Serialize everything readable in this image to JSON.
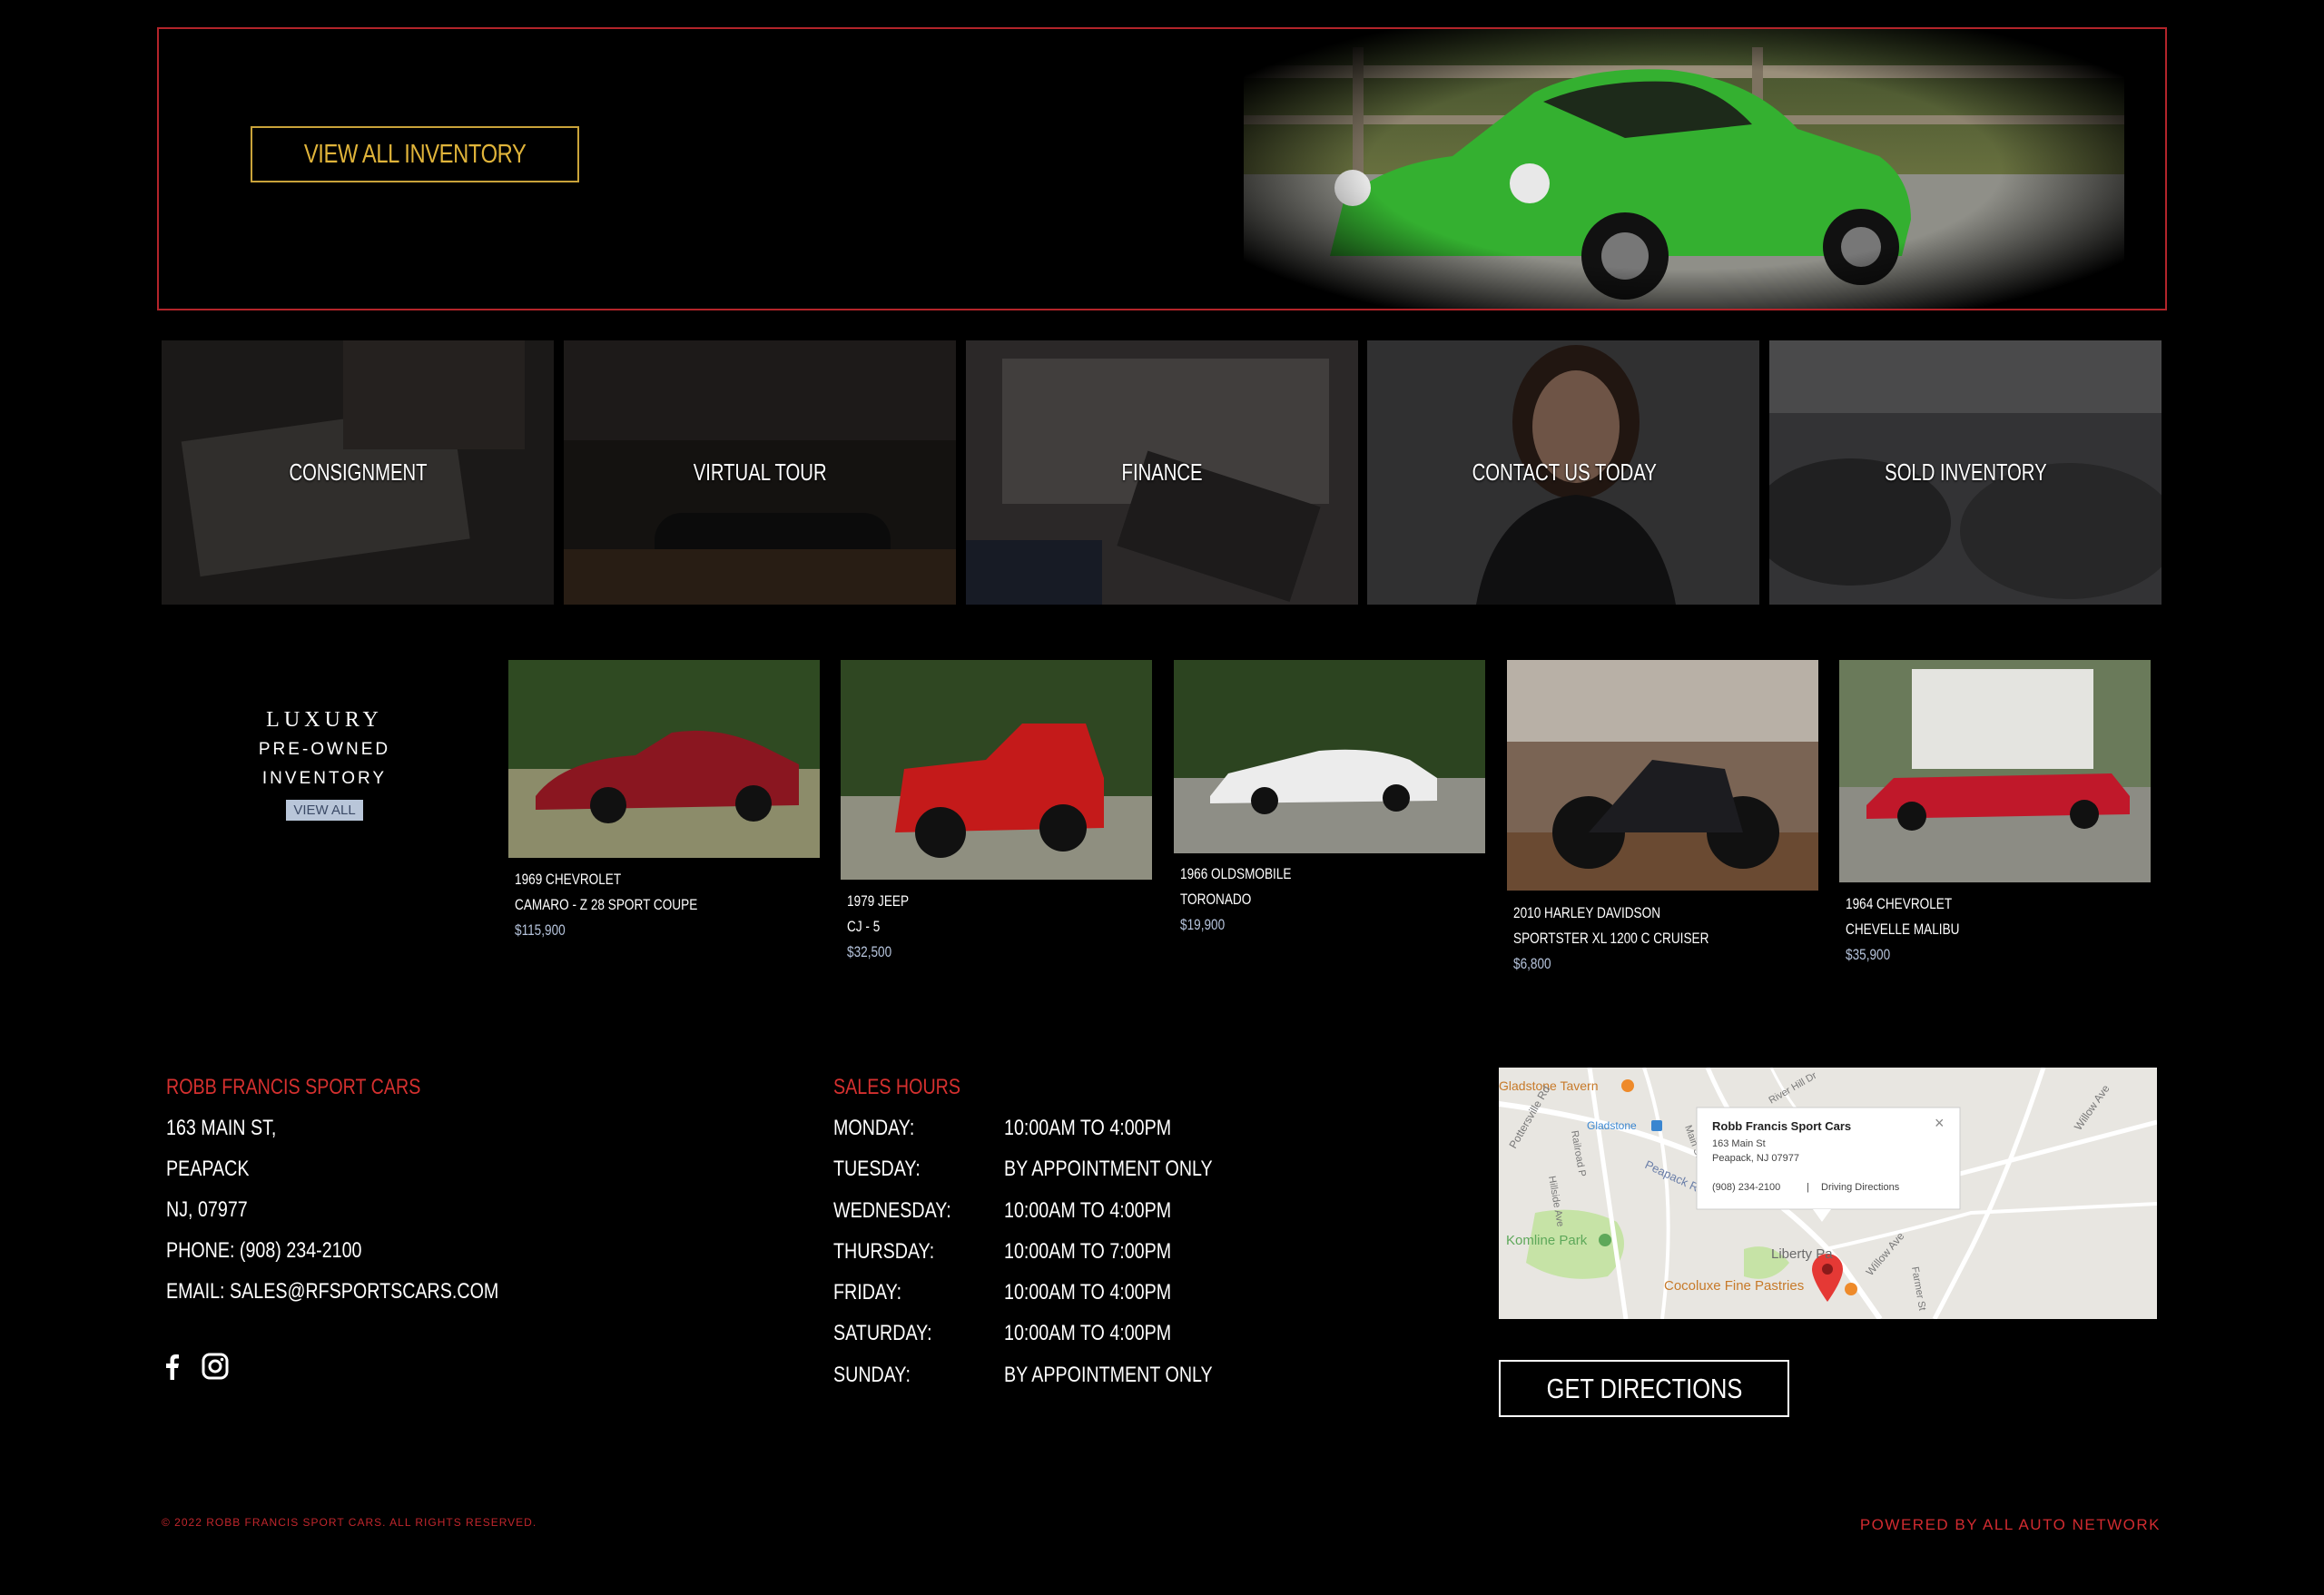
{
  "hero": {
    "button_label": "VIEW ALL INVENTORY"
  },
  "tiles": [
    {
      "label": "CONSIGNMENT"
    },
    {
      "label": "VIRTUAL TOUR"
    },
    {
      "label": "FINANCE"
    },
    {
      "label": "CONTACT US TODAY"
    },
    {
      "label": "SOLD INVENTORY"
    }
  ],
  "luxury": {
    "line1": "LUXURY",
    "line2": "PRE-OWNED",
    "line3": "INVENTORY",
    "view_all": "VIEW ALL"
  },
  "cars": [
    {
      "year_make": "1969 CHEVROLET",
      "model": "CAMARO - Z 28 SPORT COUPE",
      "price": "$115,900"
    },
    {
      "year_make": "1979 JEEP",
      "model": "CJ - 5",
      "price": "$32,500"
    },
    {
      "year_make": "1966 OLDSMOBILE",
      "model": "TORONADO",
      "price": "$19,900"
    },
    {
      "year_make": "2010 HARLEY DAVIDSON",
      "model": "SPORTSTER XL 1200 C CRUISER",
      "price": "$6,800"
    },
    {
      "year_make": "1964 CHEVROLET",
      "model": "CHEVELLE MALIBU",
      "price": "$35,900"
    }
  ],
  "contact": {
    "title": "ROBB FRANCIS SPORT CARS",
    "street": "163 MAIN ST,",
    "city": "PEAPACK",
    "state_zip": "NJ, 07977",
    "phone": "PHONE: (908) 234-2100",
    "email": "EMAIL: SALES@RFSPORTSCARS.COM"
  },
  "hours": {
    "title": "SALES HOURS",
    "rows": [
      {
        "day": "MONDAY:",
        "time": "10:00AM TO 4:00PM"
      },
      {
        "day": "TUESDAY:",
        "time": "BY APPOINTMENT ONLY"
      },
      {
        "day": "WEDNESDAY:",
        "time": "10:00AM TO 4:00PM"
      },
      {
        "day": "THURSDAY:",
        "time": "10:00AM TO 7:00PM"
      },
      {
        "day": "FRIDAY:",
        "time": "10:00AM TO 4:00PM"
      },
      {
        "day": "SATURDAY:",
        "time": "10:00AM TO 4:00PM"
      },
      {
        "day": "SUNDAY:",
        "time": "BY APPOINTMENT ONLY"
      }
    ]
  },
  "map": {
    "popup_title": "Robb Francis Sport Cars",
    "popup_addr1": "163 Main St",
    "popup_addr2": "Peapack, NJ 07977",
    "popup_phone": "(908) 234-2100",
    "popup_sep": "|",
    "popup_link": "Driving Directions",
    "close": "×",
    "labels": {
      "tavern": "Gladstone Tavern",
      "gladstone": "Gladstone",
      "komline": "Komline Park",
      "liberty": "Liberty Pa",
      "cocoluxe": "Cocoluxe Fine Pastries",
      "potterville": "Pottersville Rd",
      "willow": "Willow Ave",
      "willow2": "Willow Ave",
      "peapack": "Peapack R",
      "hillside": "Hillside Ave",
      "railroad": "Railroad P",
      "main": "Main St",
      "river": "River Hill Dr",
      "farmer": "Farmer St"
    }
  },
  "directions_label": "GET DIRECTIONS",
  "social": [
    "facebook-icon",
    "instagram-icon"
  ],
  "copyright": "© 2022 ROBB FRANCIS SPORT CARS. ALL RIGHTS RESERVED.",
  "powered_by": "POWERED BY ALL AUTO NETWORK",
  "colors": {
    "accent_red": "#d5302f",
    "gold": "#e0b43a",
    "price_blue": "#b5c3db"
  }
}
